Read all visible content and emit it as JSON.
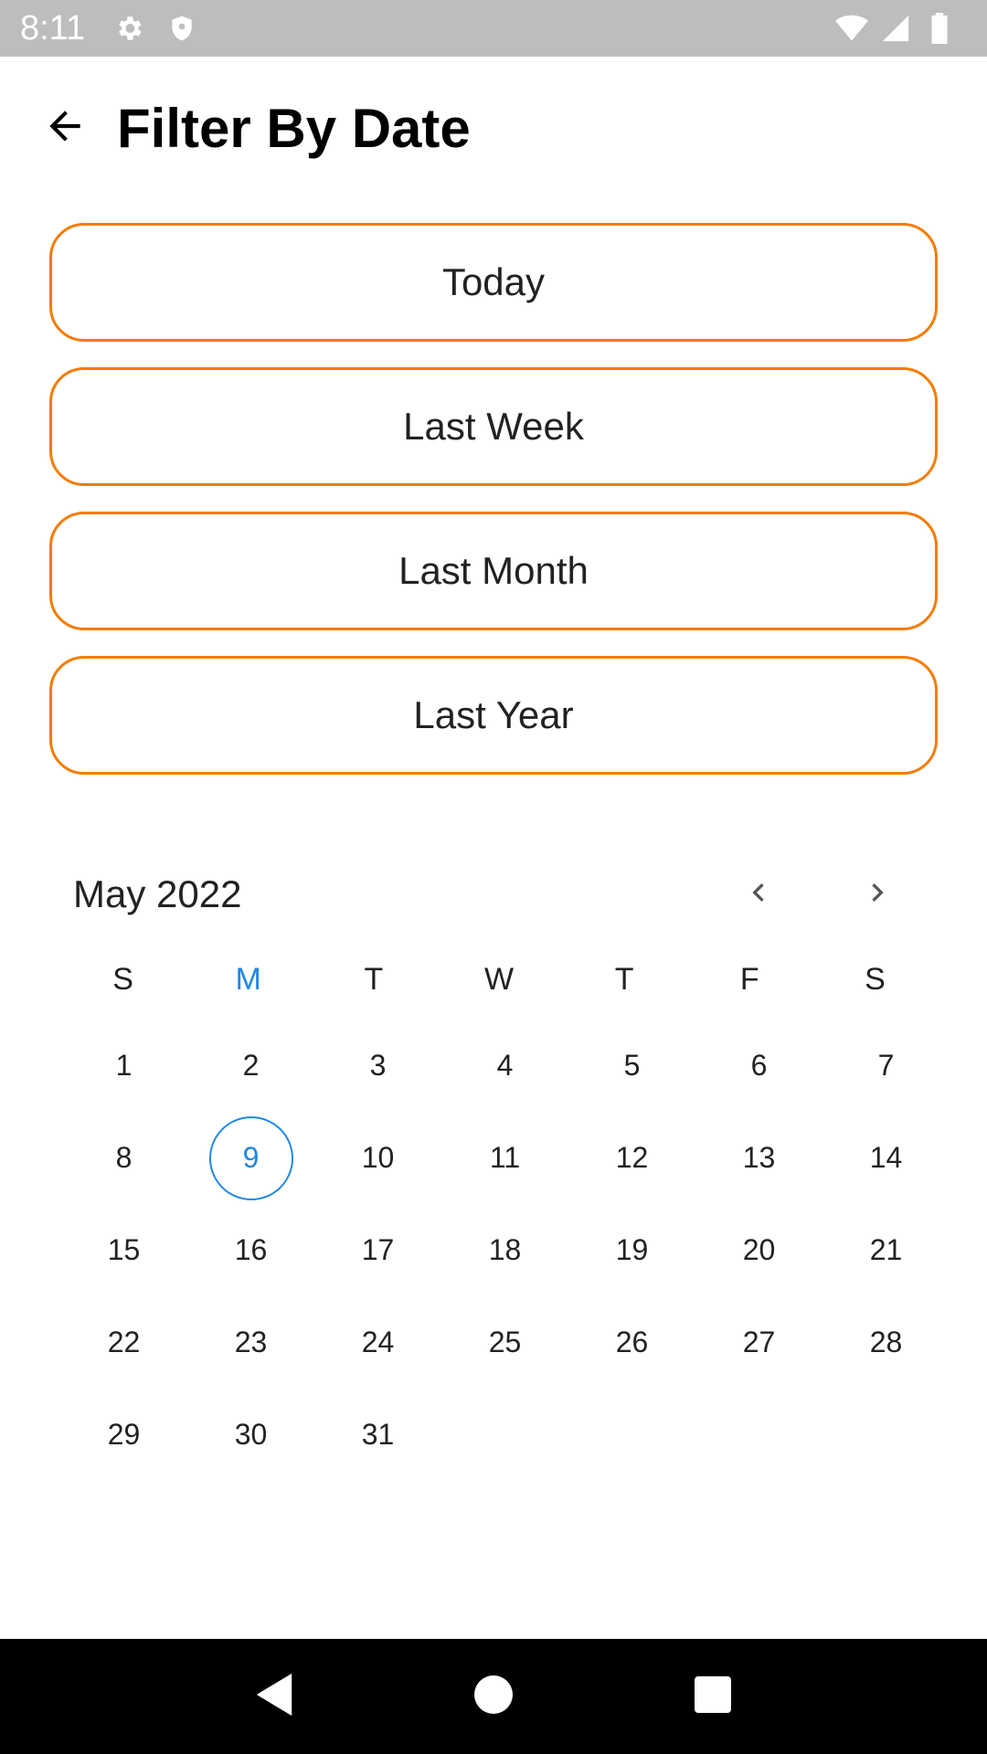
{
  "status_bar": {
    "time": "8:11",
    "left_icons": [
      "gear-icon",
      "shield-icon"
    ],
    "right_icons": [
      "wifi-icon",
      "signal-icon",
      "battery-icon"
    ]
  },
  "header": {
    "title": "Filter By Date",
    "back_icon": "arrow-left-icon"
  },
  "filters": [
    {
      "label": "Today"
    },
    {
      "label": "Last Week"
    },
    {
      "label": "Last Month"
    },
    {
      "label": "Last Year"
    }
  ],
  "calendar": {
    "month_label": "May 2022",
    "weekdays": [
      "S",
      "M",
      "T",
      "W",
      "T",
      "F",
      "S"
    ],
    "current_weekday_index": 1,
    "first_weekday_offset": 0,
    "days": [
      "1",
      "2",
      "3",
      "4",
      "5",
      "6",
      "7",
      "8",
      "9",
      "10",
      "11",
      "12",
      "13",
      "14",
      "15",
      "16",
      "17",
      "18",
      "19",
      "20",
      "21",
      "22",
      "23",
      "24",
      "25",
      "26",
      "27",
      "28",
      "29",
      "30",
      "31"
    ],
    "today": "9",
    "prev_icon": "chevron-left-icon",
    "next_icon": "chevron-right-icon"
  },
  "colors": {
    "accent_orange": "#f57c00",
    "accent_blue": "#1e88e5",
    "status_bar": "#bdbdbd",
    "nav_bar": "#000000"
  },
  "nav_bar": {
    "icons": [
      "back-triangle-icon",
      "home-circle-icon",
      "recents-square-icon"
    ]
  }
}
